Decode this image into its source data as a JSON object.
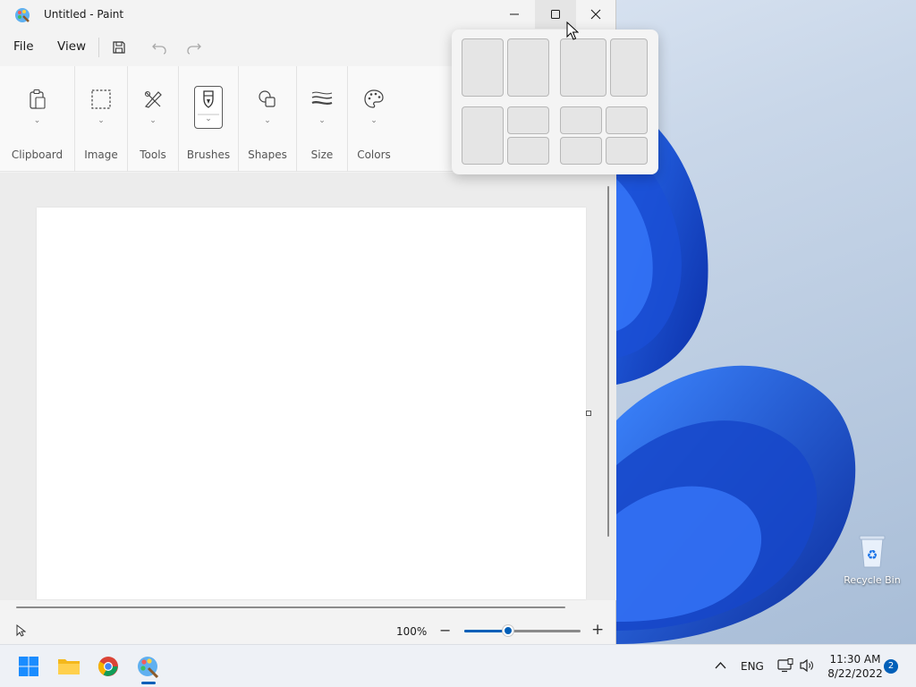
{
  "window": {
    "title": "Untitled - Paint"
  },
  "menubar": {
    "file": "File",
    "view": "View"
  },
  "ribbon": {
    "groups": [
      {
        "label": "Clipboard",
        "icon": "clipboard-icon"
      },
      {
        "label": "Image",
        "icon": "select-icon"
      },
      {
        "label": "Tools",
        "icon": "tools-icon"
      },
      {
        "label": "Brushes",
        "icon": "brush-icon"
      },
      {
        "label": "Shapes",
        "icon": "shapes-icon"
      },
      {
        "label": "Size",
        "icon": "size-icon"
      },
      {
        "label": "Colors",
        "icon": "palette-icon"
      }
    ]
  },
  "statusbar": {
    "zoom_percent": "100%",
    "zoom_level": 0.38
  },
  "snap_layouts": {
    "layouts": [
      "two-halves",
      "two-columns",
      "left-half-right-stacked",
      "four-quadrants"
    ]
  },
  "desktop": {
    "recycle_bin_label": "Recycle Bin"
  },
  "taskbar": {
    "apps": [
      "start",
      "file-explorer",
      "chrome",
      "paint"
    ],
    "language": "ENG",
    "time": "11:30 AM",
    "date": "8/22/2022",
    "notification_count": "2"
  },
  "colors": {
    "accent": "#005fb8",
    "window_bg": "#f3f3f3",
    "canvas": "#ffffff"
  }
}
